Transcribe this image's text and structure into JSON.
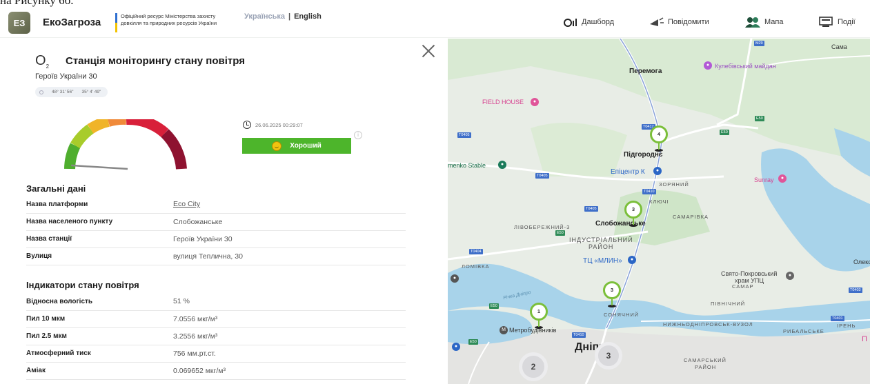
{
  "caption": "на Рисунку 6б.",
  "header": {
    "logo": "ЕЗ",
    "brand": "ЕкоЗагроза",
    "ministry": "Офіційний ресурс Міністерства захисту довкілля та природних ресурсів України",
    "lang_ua": "Українська",
    "lang_sep": "|",
    "lang_en": "English",
    "nav": [
      {
        "label": "Дашборд",
        "icon": "dashboard-icon"
      },
      {
        "label": "Повідомити",
        "icon": "megaphone-icon"
      },
      {
        "label": "Мапа",
        "icon": "people-map-icon"
      },
      {
        "label": "Події",
        "icon": "monitor-icon"
      }
    ]
  },
  "station": {
    "icon_label": "O",
    "icon_sub": "2",
    "title": "Станція моніторингу стану повітря",
    "subtitle": "Героїв України 30",
    "lat": "48° 31' 56\"",
    "lon": "35° 4' 49\"",
    "timestamp": "26.06.2025 00:29:07",
    "status": "Хороший",
    "gauge_level": 0.02
  },
  "general": {
    "title": "Загальні дані",
    "rows": [
      {
        "key": "Назва платформи",
        "value": "Eco City"
      },
      {
        "key": "Назва населеного пункту",
        "value": "Слобожанське"
      },
      {
        "key": "Назва станції",
        "value": "Героїв України 30"
      },
      {
        "key": "Вулиця",
        "value": "вулиця Теплична, 30"
      }
    ]
  },
  "indicators": {
    "title": "Індикатори стану повітря",
    "rows": [
      {
        "key": "Відносна вологість",
        "value": "51 %"
      },
      {
        "key": "Пил 10 мкм",
        "value": "7.0556 мкг/м³"
      },
      {
        "key": "Пил 2.5 мкм",
        "value": "3.2556 мкг/м³"
      },
      {
        "key": "Атмосферний тиск",
        "value": "756 мм.рт.ст."
      },
      {
        "key": "Аміак",
        "value": "0.069652 мкг/м³"
      }
    ]
  },
  "map": {
    "labels": {
      "perемога": "Перемога",
      "kulebivsky": "Кулебівський майдан",
      "field_house": "FIELD HOUSE",
      "pidhorodne": "Підгороднє",
      "menko": "menko Stable",
      "epicentr": "Епіцентр К",
      "sunray": "Sunray",
      "zoryanyi": "ЗОРЯНИЙ",
      "klyuchi": "КЛЮЧІ",
      "samarivka": "САМАРІВКА",
      "livoberezhny": "ЛІВОБЕРЕЖНИЙ-3",
      "slobozhanske": "Слобожанське",
      "industrial": "ІНДУСТРІАЛЬНИЙ",
      "raion": "РАЙОН",
      "mlyn": "ТЦ «МЛИН»",
      "olek": "Олекс",
      "lomivka": "ЛОМІВКА",
      "svyato": "Свято-Покровський",
      "hram": "храм УПЦ",
      "samar": "САМАР",
      "pivnichny": "ПІВНІЧНИЙ",
      "sonyachny": "СОНЯЧНИЙ",
      "metro": "Метробудівників",
      "nyzhnyo": "НИЖНЬОДНІПРОВСЬК-ВУЗОЛ",
      "rybalske": "РИБАЛЬСЬКЕ",
      "ireny": "ІРЕНЬ",
      "dnipro": "Дніпро",
      "samarsky": "САМАРСЬКИЙ",
      "raion2": "РАЙОН",
      "sama": "Сама",
      "river": "Річка Дніпро",
      "p": "П"
    },
    "shields": [
      "M29",
      "T0405",
      "T0417",
      "E50",
      "E50",
      "T0405",
      "T0410",
      "T0405",
      "E50",
      "T0404",
      "E50",
      "T0403",
      "T0401",
      "T0410",
      "E50"
    ],
    "markers": [
      "4",
      "3",
      "3",
      "1"
    ],
    "clusters": [
      "2",
      "3"
    ]
  },
  "colors": {
    "status_good": "#4db52b",
    "marker": "#7bbf3a",
    "water": "#a8d3ea",
    "green_area": "#c9e6c2"
  }
}
